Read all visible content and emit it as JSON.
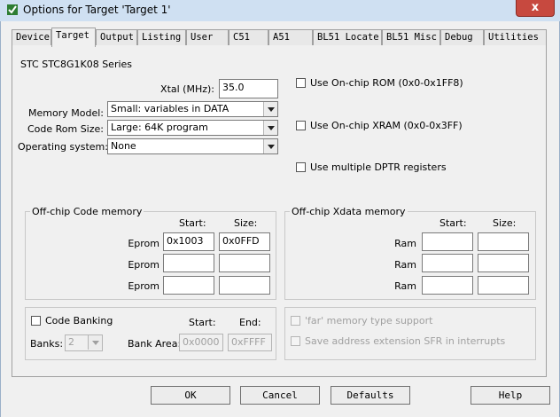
{
  "window": {
    "title": "Options for Target 'Target 1'",
    "close_glyph": "x"
  },
  "tabs": [
    {
      "label": "Device"
    },
    {
      "label": "Target"
    },
    {
      "label": "Output"
    },
    {
      "label": "Listing"
    },
    {
      "label": "User"
    },
    {
      "label": "C51"
    },
    {
      "label": "A51"
    },
    {
      "label": "BL51 Locate"
    },
    {
      "label": "BL51 Misc"
    },
    {
      "label": "Debug"
    },
    {
      "label": "Utilities"
    }
  ],
  "active_tab": "Target",
  "device_name": "STC STC8G1K08 Series",
  "xtal": {
    "label": "Xtal (MHz):",
    "value": "35.0"
  },
  "memory_model": {
    "label": "Memory Model:",
    "value": "Small: variables in DATA"
  },
  "code_rom_size": {
    "label": "Code Rom Size:",
    "value": "Large: 64K program"
  },
  "operating_system": {
    "label": "Operating system:",
    "value": "None"
  },
  "options": {
    "onchip_rom": {
      "label": "Use On-chip ROM (0x0-0x1FF8)",
      "checked": false
    },
    "onchip_xram": {
      "label": "Use On-chip XRAM (0x0-0x3FF)",
      "checked": false
    },
    "multiple_dptr": {
      "label": "Use multiple DPTR registers",
      "checked": false
    }
  },
  "offchip_code": {
    "title": "Off-chip Code memory",
    "start_header": "Start:",
    "size_header": "Size:",
    "rows": [
      {
        "label": "Eprom",
        "start": "0x1003",
        "size": "0x0FFD"
      },
      {
        "label": "Eprom",
        "start": "",
        "size": ""
      },
      {
        "label": "Eprom",
        "start": "",
        "size": ""
      }
    ]
  },
  "offchip_xdata": {
    "title": "Off-chip Xdata memory",
    "start_header": "Start:",
    "size_header": "Size:",
    "rows": [
      {
        "label": "Ram",
        "start": "",
        "size": ""
      },
      {
        "label": "Ram",
        "start": "",
        "size": ""
      },
      {
        "label": "Ram",
        "start": "",
        "size": ""
      }
    ]
  },
  "code_banking": {
    "label": "Code Banking",
    "checked": false,
    "start_header": "Start:",
    "end_header": "End:",
    "banks_label": "Banks:",
    "banks_value": "2",
    "bank_area_label": "Bank Area:",
    "bank_area_start": "0x0000",
    "bank_area_end": "0xFFFF"
  },
  "far_options": {
    "far_memory": {
      "label": "'far' memory type support",
      "checked": false
    },
    "save_sfr": {
      "label": "Save address extension SFR in interrupts",
      "checked": false
    }
  },
  "buttons": {
    "ok": "OK",
    "cancel": "Cancel",
    "defaults": "Defaults",
    "help": "Help"
  }
}
